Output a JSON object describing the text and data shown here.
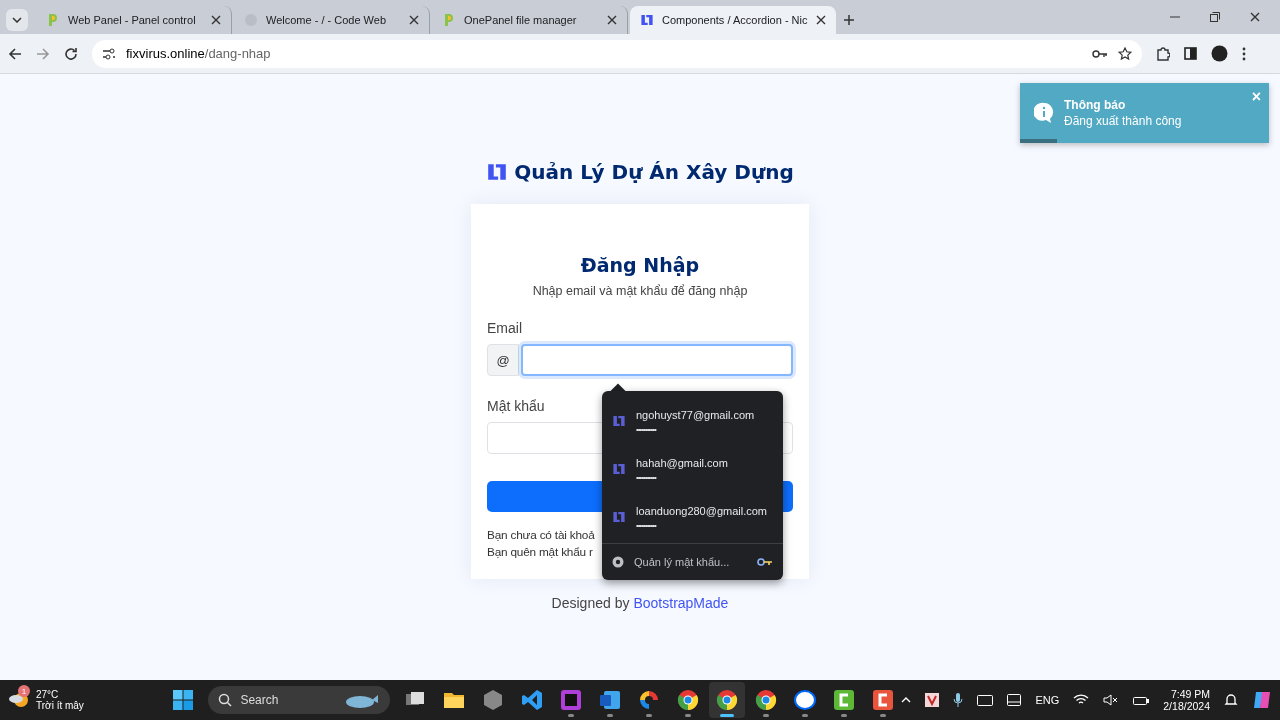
{
  "browser": {
    "tabs": [
      {
        "title": "Web Panel - Panel control",
        "kind": "panel",
        "selected": false
      },
      {
        "title": "Welcome - / - Code Web",
        "kind": "faded",
        "selected": false
      },
      {
        "title": "OnePanel file manager",
        "kind": "panel",
        "selected": false
      },
      {
        "title": "Components / Accordion - Nic",
        "kind": "logo",
        "selected": true
      }
    ],
    "address": {
      "host": "fixvirus.online",
      "path": "/dang-nhap"
    }
  },
  "toast": {
    "title": "Thông báo",
    "message": "Đăng xuất thành công",
    "close": "×",
    "level": 0.15
  },
  "brand": {
    "name": "Quản Lý Dự Án Xây Dựng"
  },
  "login": {
    "title": "Đăng Nhập",
    "subtitle": "Nhập email và mật khẩu để đăng nhập",
    "email_label": "Email",
    "email_prefix": "@",
    "email_focused": true,
    "password_label": "Mật khẩu",
    "links": [
      "Bạn chưa có tài khoả",
      "Bạn quên mật khẩu r"
    ]
  },
  "autofill": {
    "accounts": [
      {
        "email": "ngohuyst77@gmail.com",
        "password": "•••••••••••"
      },
      {
        "email": "hahah@gmail.com",
        "password": "•••••••••••"
      },
      {
        "email": "loanduong280@gmail.com",
        "password": "•••••••••••"
      }
    ],
    "manage": "Quản lý mật khẩu..."
  },
  "footer": {
    "text": "Designed by",
    "link": "BootstrapMade"
  },
  "taskbar": {
    "weather": {
      "temp": "27°C",
      "desc": "Trời ít mây",
      "badge": "1"
    },
    "search": "Search",
    "apps": [
      {
        "kind": "taskview",
        "selected": false
      },
      {
        "kind": "folder",
        "selected": false
      },
      {
        "kind": "cube",
        "selected": false
      },
      {
        "kind": "vscode",
        "selected": false
      },
      {
        "kind": "storm",
        "selected": false
      },
      {
        "kind": "word",
        "selected": false
      },
      {
        "kind": "swirl",
        "selected": false
      },
      {
        "kind": "chrome",
        "selected": false
      },
      {
        "kind": "chrome",
        "selected": true
      },
      {
        "kind": "chrome",
        "selected": false
      },
      {
        "kind": "chat",
        "selected": false
      },
      {
        "kind": "green",
        "selected": false
      },
      {
        "kind": "red",
        "selected": false
      }
    ],
    "lang": "ENG",
    "time": "7:49 PM",
    "date": "2/18/2024"
  }
}
